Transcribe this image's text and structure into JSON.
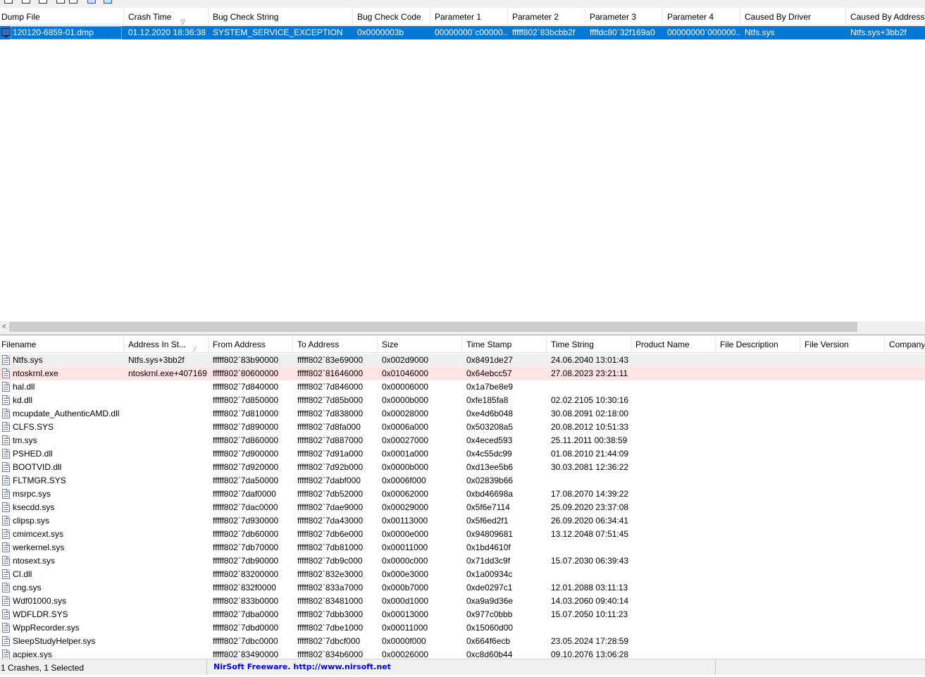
{
  "crash_list": {
    "columns": [
      "Dump File",
      "Crash Time",
      "Bug Check String",
      "Bug Check Code",
      "Parameter 1",
      "Parameter 2",
      "Parameter 3",
      "Parameter 4",
      "Caused By Driver",
      "Caused By Address"
    ],
    "rows": [
      [
        "120120-6859-01.dmp",
        "01.12.2020 18:36:38",
        "SYSTEM_SERVICE_EXCEPTION",
        "0x0000003b",
        "00000000`c00000...",
        "fffff802`83bcbb2f",
        "ffffdc80`32f169a0",
        "00000000`000000...",
        "Ntfs.sys",
        "Ntfs.sys+3bb2f"
      ]
    ]
  },
  "module_list": {
    "columns": [
      "Filename",
      "Address In St...",
      "From Address",
      "To Address",
      "Size",
      "Time Stamp",
      "Time String",
      "Product Name",
      "File Description",
      "File Version",
      "Company"
    ],
    "rows": [
      [
        "Ntfs.sys",
        "Ntfs.sys+3bb2f",
        "fffff802`83b90000",
        "fffff802`83e69000",
        "0x002d9000",
        "0x8491de27",
        "24.06.2040 13:01:43",
        "",
        "",
        "",
        ""
      ],
      [
        "ntoskrnl.exe",
        "ntoskrnl.exe+407169",
        "fffff802`80600000",
        "fffff802`81646000",
        "0x01046000",
        "0x64ebcc57",
        "27.08.2023 23:21:11",
        "",
        "",
        "",
        ""
      ],
      [
        "hal.dll",
        "",
        "fffff802`7d840000",
        "fffff802`7d846000",
        "0x00006000",
        "0x1a7be8e9",
        "",
        "",
        "",
        "",
        ""
      ],
      [
        "kd.dll",
        "",
        "fffff802`7d850000",
        "fffff802`7d85b000",
        "0x0000b000",
        "0xfe185fa8",
        "02.02.2105 10:30:16",
        "",
        "",
        "",
        ""
      ],
      [
        "mcupdate_AuthenticAMD.dll",
        "",
        "fffff802`7d810000",
        "fffff802`7d838000",
        "0x00028000",
        "0xe4d6b048",
        "30.08.2091 02:18:00",
        "",
        "",
        "",
        ""
      ],
      [
        "CLFS.SYS",
        "",
        "fffff802`7d890000",
        "fffff802`7d8fa000",
        "0x0006a000",
        "0x503208a5",
        "20.08.2012 10:51:33",
        "",
        "",
        "",
        ""
      ],
      [
        "tm.sys",
        "",
        "fffff802`7d860000",
        "fffff802`7d887000",
        "0x00027000",
        "0x4eced593",
        "25.11.2011 00:38:59",
        "",
        "",
        "",
        ""
      ],
      [
        "PSHED.dll",
        "",
        "fffff802`7d900000",
        "fffff802`7d91a000",
        "0x0001a000",
        "0x4c55dc99",
        "01.08.2010 21:44:09",
        "",
        "",
        "",
        ""
      ],
      [
        "BOOTVID.dll",
        "",
        "fffff802`7d920000",
        "fffff802`7d92b000",
        "0x0000b000",
        "0xd13ee5b6",
        "30.03.2081 12:36:22",
        "",
        "",
        "",
        ""
      ],
      [
        "FLTMGR.SYS",
        "",
        "fffff802`7da50000",
        "fffff802`7dabf000",
        "0x0006f000",
        "0x02839b66",
        "",
        "",
        "",
        "",
        ""
      ],
      [
        "msrpc.sys",
        "",
        "fffff802`7daf0000",
        "fffff802`7db52000",
        "0x00062000",
        "0xbd46698a",
        "17.08.2070 14:39:22",
        "",
        "",
        "",
        ""
      ],
      [
        "ksecdd.sys",
        "",
        "fffff802`7dac0000",
        "fffff802`7dae9000",
        "0x00029000",
        "0x5f6e7114",
        "25.09.2020 23:37:08",
        "",
        "",
        "",
        ""
      ],
      [
        "clipsp.sys",
        "",
        "fffff802`7d930000",
        "fffff802`7da43000",
        "0x00113000",
        "0x5f6ed2f1",
        "26.09.2020 06:34:41",
        "",
        "",
        "",
        ""
      ],
      [
        "cmimcext.sys",
        "",
        "fffff802`7db60000",
        "fffff802`7db6e000",
        "0x0000e000",
        "0x94809681",
        "13.12.2048 07:51:45",
        "",
        "",
        "",
        ""
      ],
      [
        "werkernel.sys",
        "",
        "fffff802`7db70000",
        "fffff802`7db81000",
        "0x00011000",
        "0x1bd4610f",
        "",
        "",
        "",
        "",
        ""
      ],
      [
        "ntosext.sys",
        "",
        "fffff802`7db90000",
        "fffff802`7db9c000",
        "0x0000c000",
        "0x71dd3c9f",
        "15.07.2030 06:39:43",
        "",
        "",
        "",
        ""
      ],
      [
        "CI.dll",
        "",
        "fffff802`83200000",
        "fffff802`832e3000",
        "0x000e3000",
        "0x1a00934c",
        "",
        "",
        "",
        "",
        ""
      ],
      [
        "cng.sys",
        "",
        "fffff802`832f0000",
        "fffff802`833a7000",
        "0x000b7000",
        "0xde0297c1",
        "12.01.2088 03:11:13",
        "",
        "",
        "",
        ""
      ],
      [
        "Wdf01000.sys",
        "",
        "fffff802`833b0000",
        "fffff802`83481000",
        "0x000d1000",
        "0xa9a9d36e",
        "14.03.2060 09:40:14",
        "",
        "",
        "",
        ""
      ],
      [
        "WDFLDR.SYS",
        "",
        "fffff802`7dba0000",
        "fffff802`7dbb3000",
        "0x00013000",
        "0x977c0bbb",
        "15.07.2050 10:11:23",
        "",
        "",
        "",
        ""
      ],
      [
        "WppRecorder.sys",
        "",
        "fffff802`7dbd0000",
        "fffff802`7dbe1000",
        "0x00011000",
        "0x15060d00",
        "",
        "",
        "",
        "",
        ""
      ],
      [
        "SleepStudyHelper.sys",
        "",
        "fffff802`7dbc0000",
        "fffff802`7dbcf000",
        "0x0000f000",
        "0x664f6ecb",
        "23.05.2024 17:28:59",
        "",
        "",
        "",
        ""
      ],
      [
        "acpiex.sys",
        "",
        "fffff802`83490000",
        "fffff802`834b6000",
        "0x00026000",
        "0xc8d60b44",
        "09.10.2076 13:06:28",
        "",
        "",
        "",
        ""
      ]
    ]
  },
  "status": {
    "summary": "1 Crashes, 1 Selected",
    "credit": "NirSoft Freeware.  http://www.nirsoft.net"
  },
  "colors": {
    "selection": "#0078d7",
    "highlight_grey": "#f0f0f0",
    "highlight_pink": "#ffe4e6",
    "link": "#0000ee"
  }
}
